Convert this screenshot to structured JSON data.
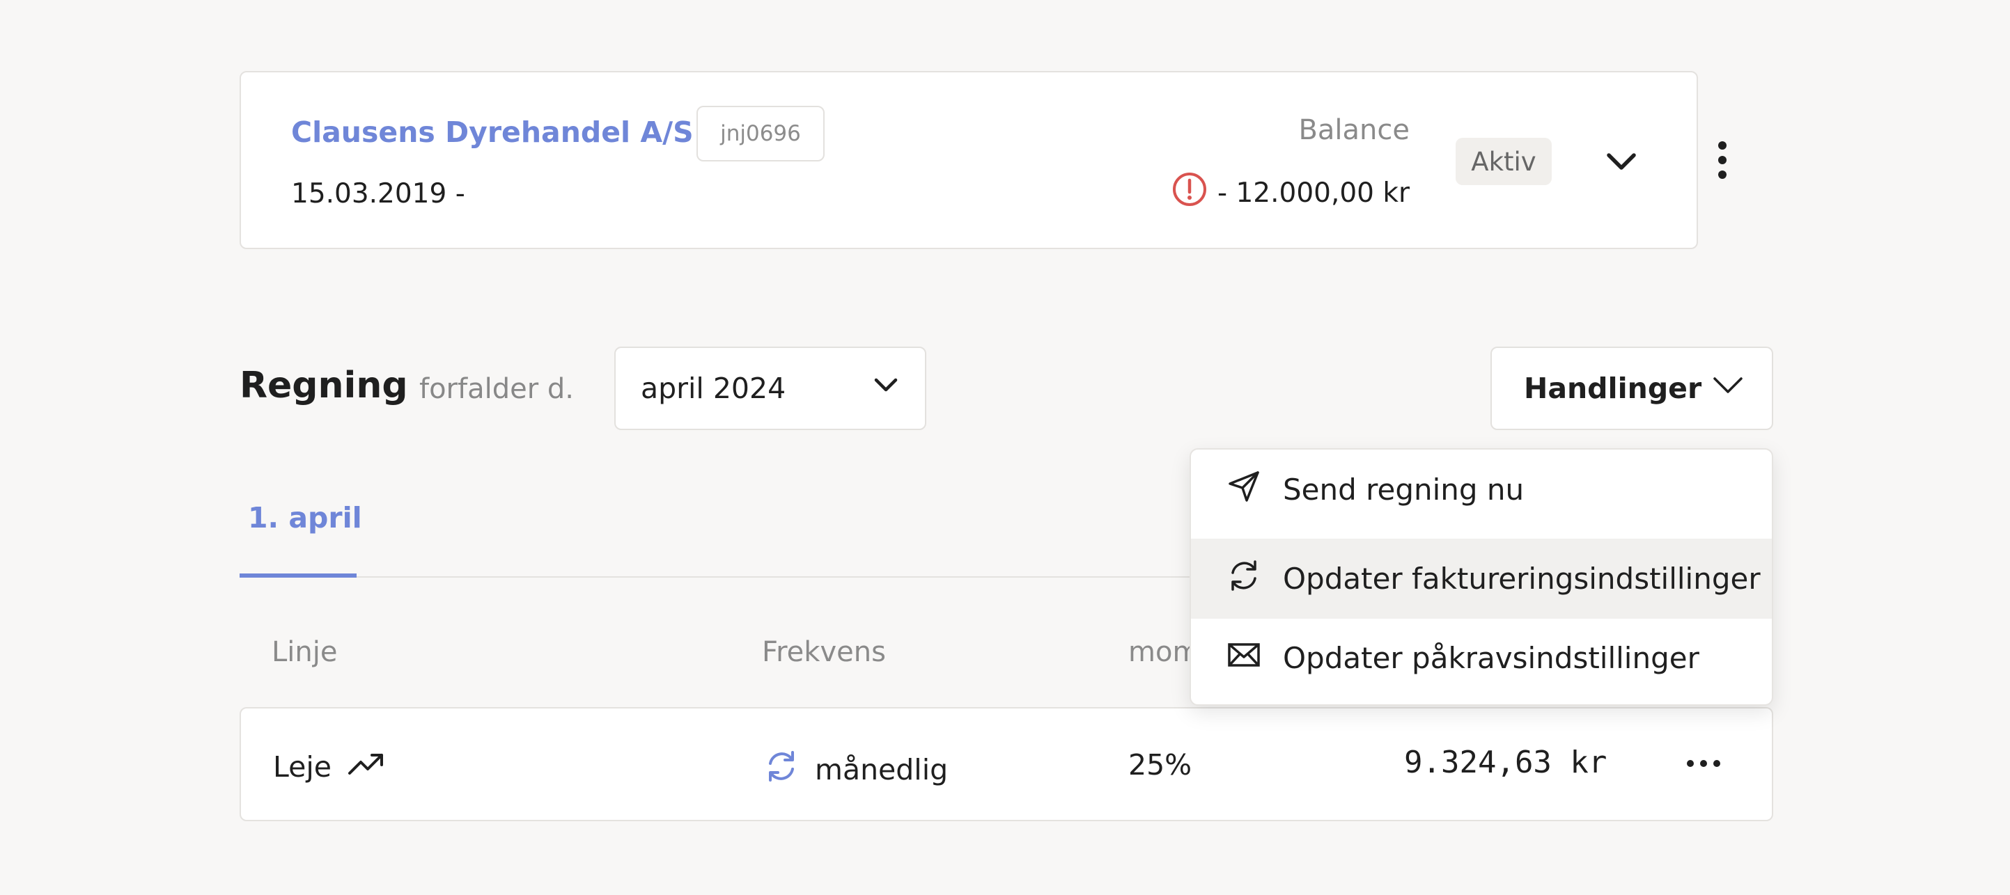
{
  "customer": {
    "name": "Clausens Dyrehandel A/S",
    "code": "jnj0696",
    "date_range": "15.03.2019 -",
    "balance_label": "Balance",
    "balance_value": "- 12.000,00 kr",
    "status": "Aktiv",
    "alert_color": "#d9534f"
  },
  "invoice": {
    "title": "Regning",
    "due_label": "forfalder d.",
    "month": "april 2024",
    "actions_label": "Handlinger"
  },
  "tabs": [
    {
      "label": "1. april",
      "active": true
    }
  ],
  "table": {
    "headers": [
      "Linje",
      "Frekvens",
      "mom"
    ],
    "rows": [
      {
        "line": "Leje",
        "frequency": "månedlig",
        "vat": "25%",
        "amount": "9.324,63 kr"
      }
    ]
  },
  "menu": {
    "items": [
      {
        "label": "Send regning nu",
        "icon": "send-icon"
      },
      {
        "label": "Opdater faktureringsindstillinger",
        "icon": "refresh-icon",
        "highlighted": true
      },
      {
        "label": "Opdater påkravsindstillinger",
        "icon": "envelope-icon"
      }
    ]
  },
  "colors": {
    "accent": "#6f86d8",
    "background": "#f8f7f6"
  }
}
